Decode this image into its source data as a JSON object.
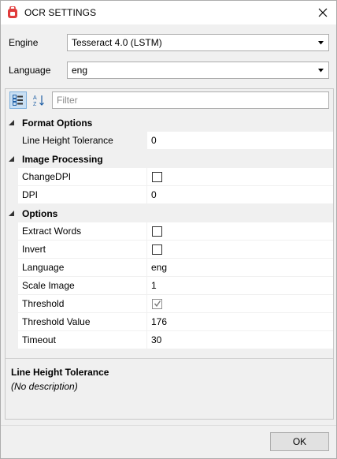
{
  "window": {
    "title": "OCR SETTINGS",
    "app_icon": "app-logo-icon",
    "close_icon": "close-icon"
  },
  "engine": {
    "label": "Engine",
    "value": "Tesseract 4.0 (LSTM)"
  },
  "language_select": {
    "label": "Language",
    "value": "eng"
  },
  "toolbar": {
    "categorized_icon": "categorized-view-icon",
    "alphabetical_icon": "sort-alphabetical-icon",
    "filter_placeholder": "Filter"
  },
  "categories": [
    {
      "label": "Format Options",
      "properties": [
        {
          "name": "Line Height Tolerance",
          "type": "text",
          "value": "0",
          "selected": true
        }
      ]
    },
    {
      "label": "Image Processing",
      "properties": [
        {
          "name": "ChangeDPI",
          "type": "checkbox",
          "checked": false
        },
        {
          "name": "DPI",
          "type": "text",
          "value": "0"
        }
      ]
    },
    {
      "label": "Options",
      "properties": [
        {
          "name": "Extract Words",
          "type": "checkbox",
          "checked": false
        },
        {
          "name": "Invert",
          "type": "checkbox",
          "checked": false
        },
        {
          "name": "Language",
          "type": "text",
          "value": "eng"
        },
        {
          "name": "Scale Image",
          "type": "text",
          "value": "1"
        },
        {
          "name": "Threshold",
          "type": "checkbox",
          "checked": true
        },
        {
          "name": "Threshold Value",
          "type": "text",
          "value": "176"
        },
        {
          "name": "Timeout",
          "type": "text",
          "value": "30"
        }
      ]
    }
  ],
  "description": {
    "title": "Line Height Tolerance",
    "text": "(No description)"
  },
  "footer": {
    "ok_label": "OK"
  },
  "colors": {
    "window_bg": "#f0f0f0",
    "grid_bg": "#ffffff",
    "accent_selected": "#c9dff3"
  }
}
